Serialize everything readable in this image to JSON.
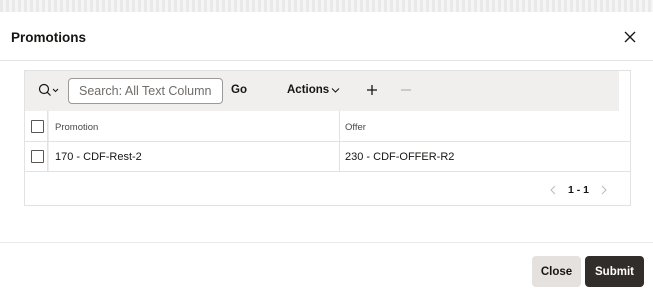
{
  "dialog": {
    "title": "Promotions",
    "close_icon": "close-icon"
  },
  "toolbar": {
    "search_icon": "search-icon",
    "search_placeholder": "Search: All Text Columns",
    "go_label": "Go",
    "actions_label": "Actions",
    "add_icon": "plus-icon",
    "remove_icon": "minus-icon"
  },
  "grid": {
    "columns": [
      "Promotion",
      "Offer"
    ],
    "rows": [
      {
        "promotion": "170 - CDF-Rest-2",
        "offer": "230 - CDF-OFFER-R2"
      }
    ]
  },
  "pagination": {
    "range": "1 - 1",
    "prev_icon": "chevron-left-icon",
    "next_icon": "chevron-right-icon"
  },
  "footer": {
    "close_label": "Close",
    "submit_label": "Submit"
  },
  "colors": {
    "toolbar_bg": "#f1efed",
    "submit_bg": "#312d2a",
    "close_bg": "#e4e1de"
  }
}
